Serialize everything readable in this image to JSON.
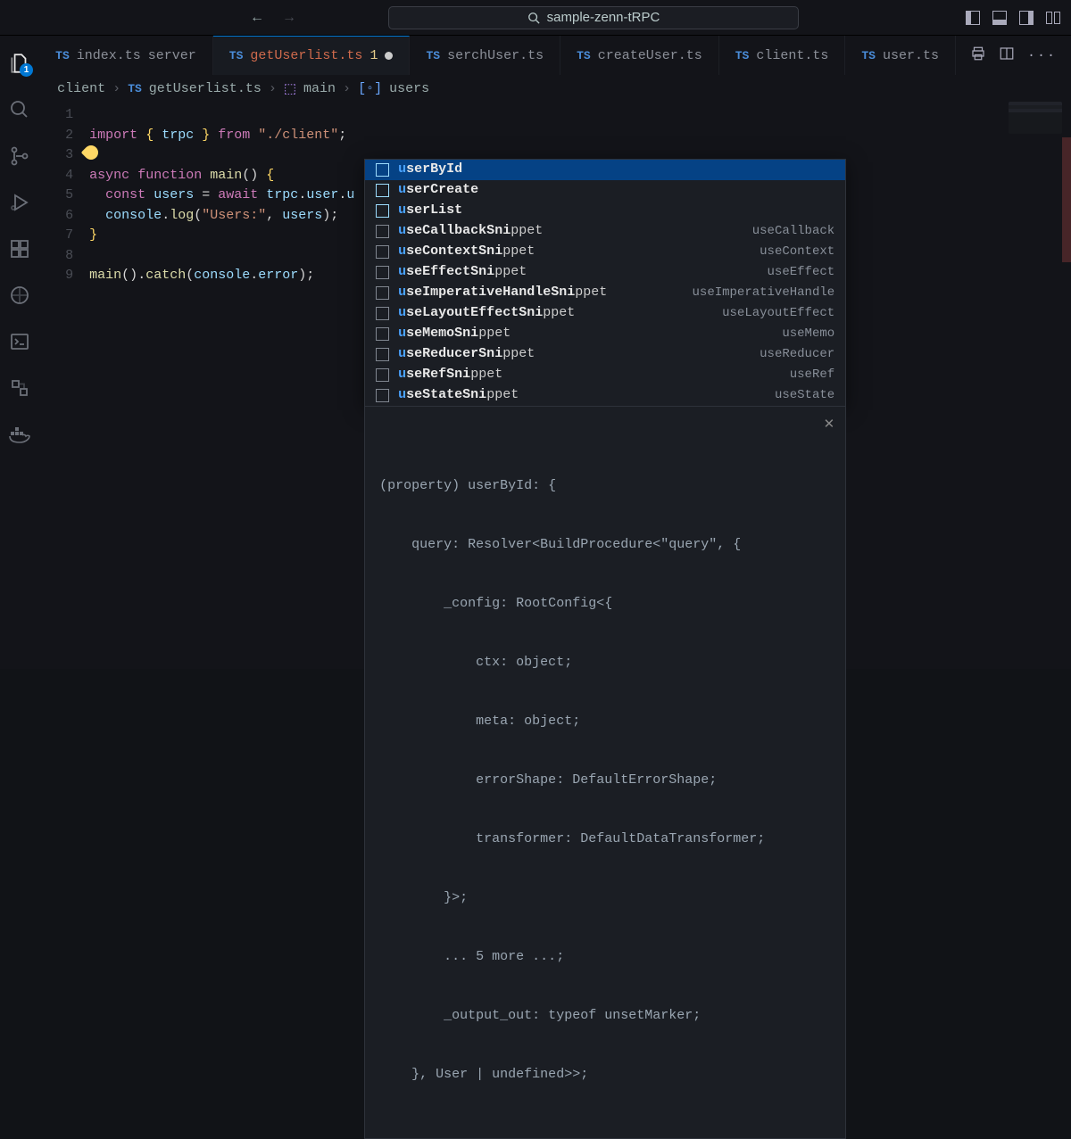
{
  "title": "sample-zenn-tRPC",
  "activitybar": {
    "badge": 1
  },
  "tabs": [
    {
      "file": "index.ts",
      "detail": "server"
    },
    {
      "file": "getUserlist.ts",
      "detail": "1",
      "active": true,
      "dirty": true
    },
    {
      "file": "serchUser.ts"
    },
    {
      "file": "createUser.ts"
    },
    {
      "file": "client.ts"
    },
    {
      "file": "user.ts"
    }
  ],
  "breadcrumbs": [
    "client",
    "getUserlist.ts",
    "main",
    "users"
  ],
  "lineNumbers": [
    "1",
    "2",
    "3",
    "4",
    "5",
    "6",
    "7",
    "8",
    "9"
  ],
  "code": {
    "l1": {
      "import_kw": "import",
      "lbrace": "{ ",
      "sym": "trpc",
      "rbrace": " }",
      "from_kw": "from",
      "path": "\"./client\"",
      "semi": ";"
    },
    "l3": {
      "async": "async",
      "func": "function",
      "name": "main",
      "parens": "()",
      "brace": "{"
    },
    "l4": {
      "const_kw": "const",
      "var": "users",
      "eq": "=",
      "await_kw": "await",
      "obj": "trpc",
      "dot1": ".",
      "prop": "user",
      "dot2": ".",
      "trail": "u"
    },
    "l5": {
      "obj": "console",
      "dot": ".",
      "method": "log",
      "lp": "(",
      "str": "\"Users:\"",
      "comma": ", ",
      "arg": "users",
      "rp": ")",
      "semi": ";"
    },
    "l6": {
      "brace": "}"
    },
    "l8": {
      "name": "main",
      "parens": "()",
      "dot": ".",
      "catch": "catch",
      "lp": "(",
      "obj": "console",
      "dot2": ".",
      "err": "error",
      "rp": ")",
      "semi": ";"
    }
  },
  "suggestions": [
    {
      "label": "userById",
      "hi": "u",
      "bold": "serById",
      "kind": "method",
      "selected": true
    },
    {
      "label": "userCreate",
      "hi": "u",
      "bold": "serCreate",
      "kind": "method"
    },
    {
      "label": "userList",
      "hi": "u",
      "bold": "serList",
      "kind": "method"
    },
    {
      "label": "useCallbackSnippet",
      "hi": "u",
      "bold1": "seCallbackSni",
      "plain": "ppet",
      "kind": "snippet",
      "desc": "useCallback"
    },
    {
      "label": "useContextSnippet",
      "hi": "u",
      "bold1": "seContextSni",
      "plain": "ppet",
      "kind": "snippet",
      "desc": "useContext"
    },
    {
      "label": "useEffectSnippet",
      "hi": "u",
      "bold1": "seEffectSni",
      "plain": "ppet",
      "kind": "snippet",
      "desc": "useEffect"
    },
    {
      "label": "useImperativeHandleSnippet",
      "hi": "u",
      "bold1": "seImperativeHandleSni",
      "plain": "ppet",
      "kind": "snippet",
      "desc": "useImperativeHandle"
    },
    {
      "label": "useLayoutEffectSnippet",
      "hi": "u",
      "bold1": "seLayoutEffectSni",
      "plain": "ppet",
      "kind": "snippet",
      "desc": "useLayoutEffect"
    },
    {
      "label": "useMemoSnippet",
      "hi": "u",
      "bold1": "seMemoSni",
      "plain": "ppet",
      "kind": "snippet",
      "desc": "useMemo"
    },
    {
      "label": "useReducerSnippet",
      "hi": "u",
      "bold1": "seReducerSni",
      "plain": "ppet",
      "kind": "snippet",
      "desc": "useReducer"
    },
    {
      "label": "useRefSnippet",
      "hi": "u",
      "bold1": "seRefSni",
      "plain": "ppet",
      "kind": "snippet",
      "desc": "useRef"
    },
    {
      "label": "useStateSnippet",
      "hi": "u",
      "bold1": "seStateSni",
      "plain": "ppet",
      "kind": "snippet",
      "desc": "useState"
    }
  ],
  "doc": {
    "l0": "(property) userById: {",
    "l1": "    query: Resolver<BuildProcedure<\"query\", {",
    "l2": "        _config: RootConfig<{",
    "l3": "            ctx: object;",
    "l4": "            meta: object;",
    "l5": "            errorShape: DefaultErrorShape;",
    "l6": "            transformer: DefaultDataTransformer;",
    "l7": "        }>;",
    "l8": "        ... 5 more ...;",
    "l9": "        _output_out: typeof unsetMarker;",
    "l10": "    }, User | undefined>>;"
  }
}
